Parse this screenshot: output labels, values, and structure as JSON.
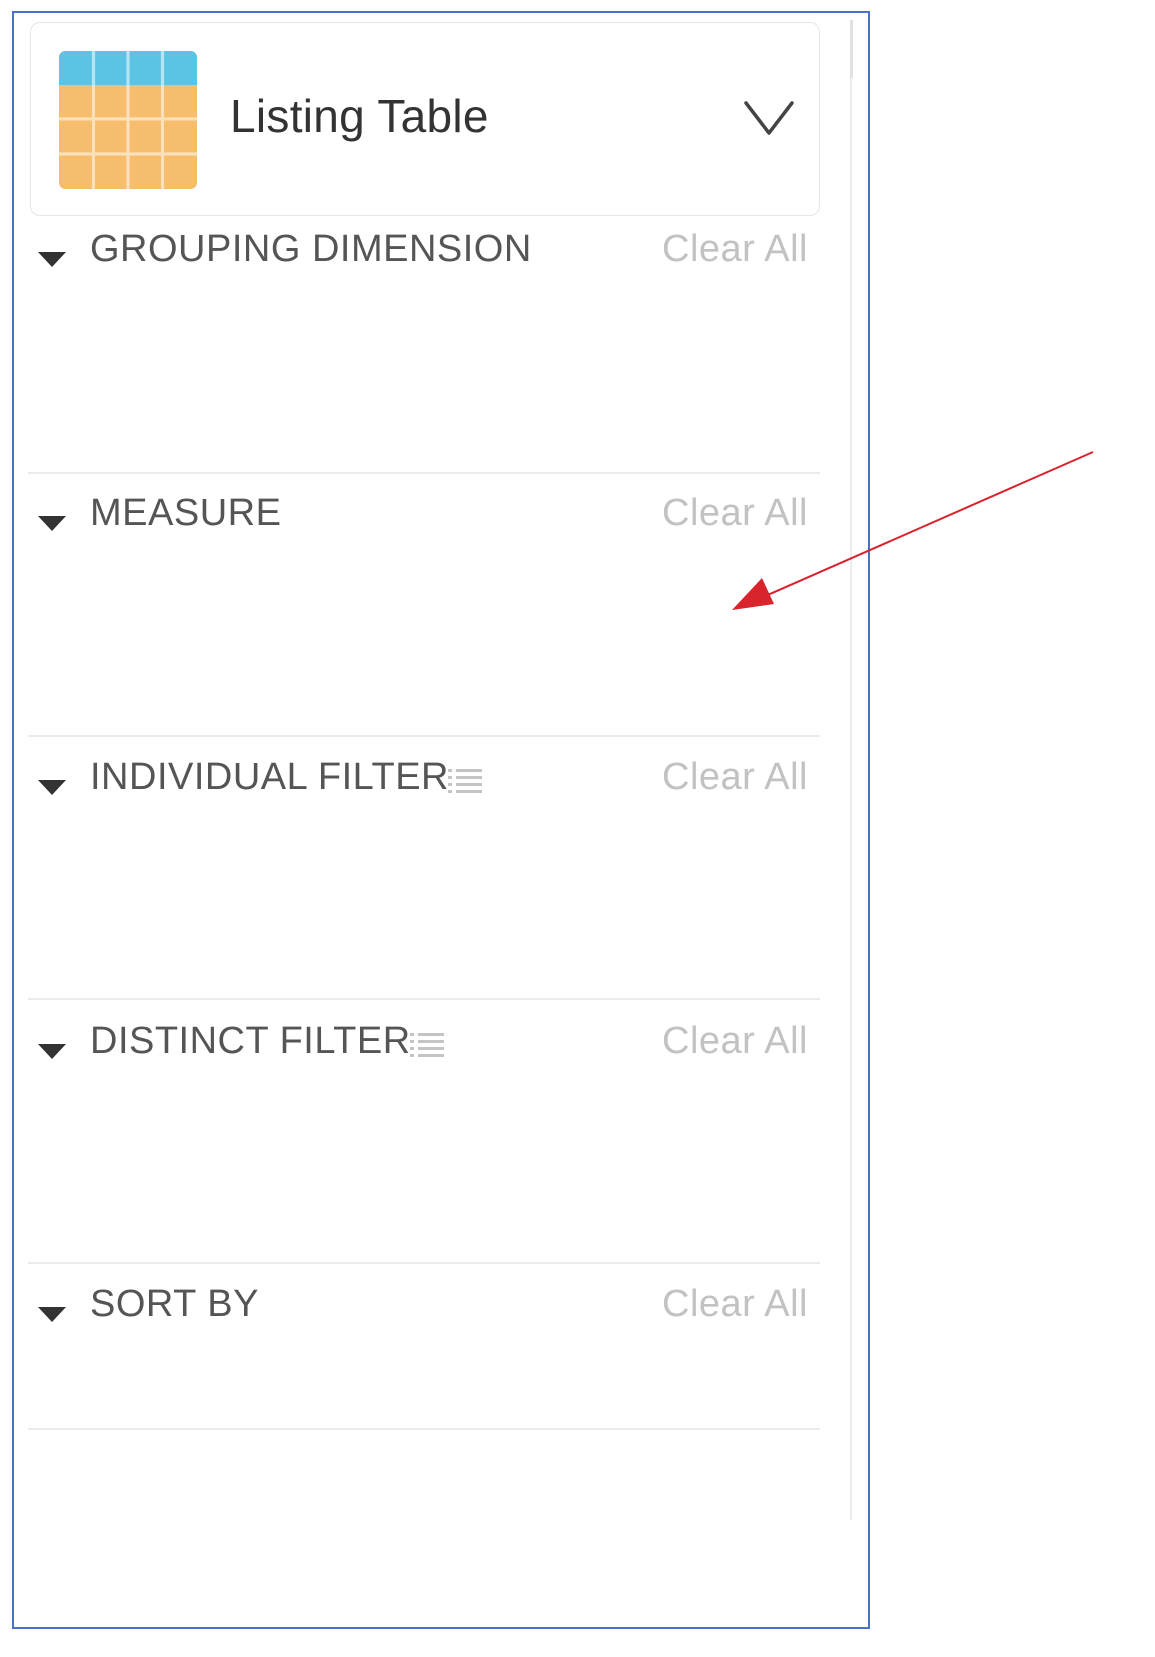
{
  "selector": {
    "label": "Listing Table",
    "icon": "table-icon",
    "dropdown_icon": "chevron-down-icon"
  },
  "sections": [
    {
      "title": "GROUPING DIMENSION",
      "clear_label": "Clear All"
    },
    {
      "title": "MEASURE",
      "clear_label": "Clear All"
    },
    {
      "title": "INDIVIDUAL FILTER",
      "clear_label": "Clear All",
      "extra_icon": "list-icon"
    },
    {
      "title": "DISTINCT FILTER",
      "clear_label": "Clear All",
      "extra_icon": "list-icon"
    },
    {
      "title": "SORT BY",
      "clear_label": "Clear All"
    }
  ],
  "colors": {
    "frame": "#4a6fc5",
    "icon_header": "#5bc4e5",
    "icon_body": "#f5bd6c",
    "annotation_arrow": "#d9232d",
    "clear_text": "#c2c2c2",
    "title_text": "#555555"
  }
}
